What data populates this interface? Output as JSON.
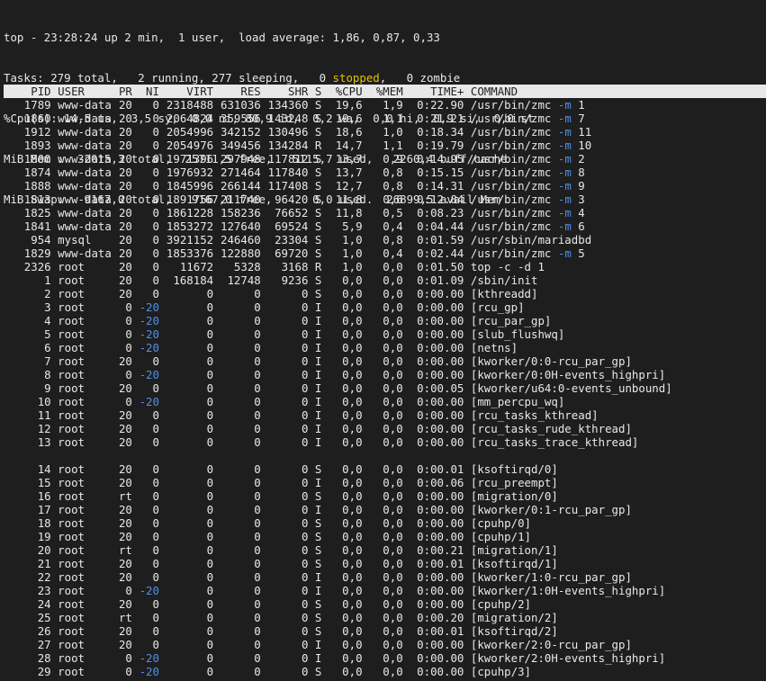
{
  "summary": {
    "top_line": "top - 23:28:24 up 2 min,  1 user,  load average: 1,86, 0,87, 0,33",
    "tasks_prefix": "Tasks: 279 total,   2 running, 277 sleeping,   0 ",
    "tasks_stopped": "stopped",
    "tasks_suffix": ",   0 zombie",
    "cpu_line": "%Cpu(s): 14,5 us,  3,5 sy,  0,0 ni, 80,9 id,  0,2 wa,  0,0 hi,  0,9 si,  0,0 st",
    "mem_line": "MiB Mem :  32015,3 total,  25711,5 free,   5115,7 used,   2260,4 buff/cache",
    "swap_line": "MiB Swap:   9167,0 total,   9167,0 free,      0,0 used.  26899,5 avail Mem"
  },
  "columns": [
    "PID",
    "USER",
    "PR",
    "NI",
    "VIRT",
    "RES",
    "SHR",
    "S",
    "%CPU",
    "%MEM",
    "TIME+",
    "COMMAND"
  ],
  "colors": {
    "ni_highlight": "#4f8fe6",
    "flag_highlight": "#4f8fe6",
    "stopped": "#e5c100"
  },
  "processes": [
    {
      "pid": "1789",
      "user": "www-data",
      "pr": "20",
      "ni": "0",
      "virt": "2318488",
      "res": "631036",
      "shr": "134360",
      "s": "S",
      "cpu": "19,6",
      "mem": "1,9",
      "time": "0:22.90",
      "cmd": "/usr/bin/zmc",
      "flag": "-m",
      "arg": "1"
    },
    {
      "pid": "1860",
      "user": "www-data",
      "pr": "20",
      "ni": "0",
      "virt": "2064824",
      "res": "359556",
      "shr": "143248",
      "s": "S",
      "cpu": "19,6",
      "mem": "1,1",
      "time": "0:21.21",
      "cmd": "/usr/bin/zmc",
      "flag": "-m",
      "arg": "7"
    },
    {
      "pid": "1912",
      "user": "www-data",
      "pr": "20",
      "ni": "0",
      "virt": "2054996",
      "res": "342152",
      "shr": "130496",
      "s": "S",
      "cpu": "18,6",
      "mem": "1,0",
      "time": "0:18.34",
      "cmd": "/usr/bin/zmc",
      "flag": "-m",
      "arg": "11"
    },
    {
      "pid": "1893",
      "user": "www-data",
      "pr": "20",
      "ni": "0",
      "virt": "2054976",
      "res": "349456",
      "shr": "134284",
      "s": "R",
      "cpu": "14,7",
      "mem": "1,1",
      "time": "0:19.79",
      "cmd": "/usr/bin/zmc",
      "flag": "-m",
      "arg": "10"
    },
    {
      "pid": "1800",
      "user": "www-data",
      "pr": "20",
      "ni": "0",
      "virt": "1971396",
      "res": "297948",
      "shr": "117812",
      "s": "S",
      "cpu": "13,7",
      "mem": "0,9",
      "time": "0:14.95",
      "cmd": "/usr/bin/zmc",
      "flag": "-m",
      "arg": "2"
    },
    {
      "pid": "1874",
      "user": "www-data",
      "pr": "20",
      "ni": "0",
      "virt": "1976932",
      "res": "271464",
      "shr": "117840",
      "s": "S",
      "cpu": "13,7",
      "mem": "0,8",
      "time": "0:15.15",
      "cmd": "/usr/bin/zmc",
      "flag": "-m",
      "arg": "8"
    },
    {
      "pid": "1888",
      "user": "www-data",
      "pr": "20",
      "ni": "0",
      "virt": "1845996",
      "res": "266144",
      "shr": "117408",
      "s": "S",
      "cpu": "12,7",
      "mem": "0,8",
      "time": "0:14.31",
      "cmd": "/usr/bin/zmc",
      "flag": "-m",
      "arg": "9"
    },
    {
      "pid": "1813",
      "user": "www-data",
      "pr": "20",
      "ni": "0",
      "virt": "1891756",
      "res": "211740",
      "shr": "96420",
      "s": "S",
      "cpu": "11,8",
      "mem": "0,6",
      "time": "0:12.84",
      "cmd": "/usr/bin/zmc",
      "flag": "-m",
      "arg": "3"
    },
    {
      "pid": "1825",
      "user": "www-data",
      "pr": "20",
      "ni": "0",
      "virt": "1861228",
      "res": "158236",
      "shr": "76652",
      "s": "S",
      "cpu": "11,8",
      "mem": "0,5",
      "time": "0:08.23",
      "cmd": "/usr/bin/zmc",
      "flag": "-m",
      "arg": "4"
    },
    {
      "pid": "1841",
      "user": "www-data",
      "pr": "20",
      "ni": "0",
      "virt": "1853272",
      "res": "127640",
      "shr": "69524",
      "s": "S",
      "cpu": "5,9",
      "mem": "0,4",
      "time": "0:04.44",
      "cmd": "/usr/bin/zmc",
      "flag": "-m",
      "arg": "6"
    },
    {
      "pid": "954",
      "user": "mysql",
      "pr": "20",
      "ni": "0",
      "virt": "3921152",
      "res": "246460",
      "shr": "23304",
      "s": "S",
      "cpu": "1,0",
      "mem": "0,8",
      "time": "0:01.59",
      "cmd": "/usr/sbin/mariadbd"
    },
    {
      "pid": "1829",
      "user": "www-data",
      "pr": "20",
      "ni": "0",
      "virt": "1853376",
      "res": "122880",
      "shr": "69720",
      "s": "S",
      "cpu": "1,0",
      "mem": "0,4",
      "time": "0:02.44",
      "cmd": "/usr/bin/zmc",
      "flag": "-m",
      "arg": "5"
    },
    {
      "pid": "2326",
      "user": "root",
      "pr": "20",
      "ni": "0",
      "virt": "11672",
      "res": "5328",
      "shr": "3168",
      "s": "R",
      "cpu": "1,0",
      "mem": "0,0",
      "time": "0:01.50",
      "cmd": "top -c -d 1"
    },
    {
      "pid": "1",
      "user": "root",
      "pr": "20",
      "ni": "0",
      "virt": "168184",
      "res": "12748",
      "shr": "9236",
      "s": "S",
      "cpu": "0,0",
      "mem": "0,0",
      "time": "0:01.09",
      "cmd": "/sbin/init"
    },
    {
      "pid": "2",
      "user": "root",
      "pr": "20",
      "ni": "0",
      "virt": "0",
      "res": "0",
      "shr": "0",
      "s": "S",
      "cpu": "0,0",
      "mem": "0,0",
      "time": "0:00.00",
      "cmd": "[kthreadd]"
    },
    {
      "pid": "3",
      "user": "root",
      "pr": "0",
      "ni": "-20",
      "virt": "0",
      "res": "0",
      "shr": "0",
      "s": "I",
      "cpu": "0,0",
      "mem": "0,0",
      "time": "0:00.00",
      "cmd": "[rcu_gp]"
    },
    {
      "pid": "4",
      "user": "root",
      "pr": "0",
      "ni": "-20",
      "virt": "0",
      "res": "0",
      "shr": "0",
      "s": "I",
      "cpu": "0,0",
      "mem": "0,0",
      "time": "0:00.00",
      "cmd": "[rcu_par_gp]"
    },
    {
      "pid": "5",
      "user": "root",
      "pr": "0",
      "ni": "-20",
      "virt": "0",
      "res": "0",
      "shr": "0",
      "s": "I",
      "cpu": "0,0",
      "mem": "0,0",
      "time": "0:00.00",
      "cmd": "[slub_flushwq]"
    },
    {
      "pid": "6",
      "user": "root",
      "pr": "0",
      "ni": "-20",
      "virt": "0",
      "res": "0",
      "shr": "0",
      "s": "I",
      "cpu": "0,0",
      "mem": "0,0",
      "time": "0:00.00",
      "cmd": "[netns]"
    },
    {
      "pid": "7",
      "user": "root",
      "pr": "20",
      "ni": "0",
      "virt": "0",
      "res": "0",
      "shr": "0",
      "s": "I",
      "cpu": "0,0",
      "mem": "0,0",
      "time": "0:00.00",
      "cmd": "[kworker/0:0-rcu_par_gp]"
    },
    {
      "pid": "8",
      "user": "root",
      "pr": "0",
      "ni": "-20",
      "virt": "0",
      "res": "0",
      "shr": "0",
      "s": "I",
      "cpu": "0,0",
      "mem": "0,0",
      "time": "0:00.00",
      "cmd": "[kworker/0:0H-events_highpri]"
    },
    {
      "pid": "9",
      "user": "root",
      "pr": "20",
      "ni": "0",
      "virt": "0",
      "res": "0",
      "shr": "0",
      "s": "I",
      "cpu": "0,0",
      "mem": "0,0",
      "time": "0:00.05",
      "cmd": "[kworker/u64:0-events_unbound]"
    },
    {
      "pid": "10",
      "user": "root",
      "pr": "0",
      "ni": "-20",
      "virt": "0",
      "res": "0",
      "shr": "0",
      "s": "I",
      "cpu": "0,0",
      "mem": "0,0",
      "time": "0:00.00",
      "cmd": "[mm_percpu_wq]"
    },
    {
      "pid": "11",
      "user": "root",
      "pr": "20",
      "ni": "0",
      "virt": "0",
      "res": "0",
      "shr": "0",
      "s": "I",
      "cpu": "0,0",
      "mem": "0,0",
      "time": "0:00.00",
      "cmd": "[rcu_tasks_kthread]"
    },
    {
      "pid": "12",
      "user": "root",
      "pr": "20",
      "ni": "0",
      "virt": "0",
      "res": "0",
      "shr": "0",
      "s": "I",
      "cpu": "0,0",
      "mem": "0,0",
      "time": "0:00.00",
      "cmd": "[rcu_tasks_rude_kthread]"
    },
    {
      "pid": "13",
      "user": "root",
      "pr": "20",
      "ni": "0",
      "virt": "0",
      "res": "0",
      "shr": "0",
      "s": "I",
      "cpu": "0,0",
      "mem": "0,0",
      "time": "0:00.00",
      "cmd": "[rcu_tasks_trace_kthread]"
    },
    {
      "blank": true
    },
    {
      "pid": "14",
      "user": "root",
      "pr": "20",
      "ni": "0",
      "virt": "0",
      "res": "0",
      "shr": "0",
      "s": "S",
      "cpu": "0,0",
      "mem": "0,0",
      "time": "0:00.01",
      "cmd": "[ksoftirqd/0]"
    },
    {
      "pid": "15",
      "user": "root",
      "pr": "20",
      "ni": "0",
      "virt": "0",
      "res": "0",
      "shr": "0",
      "s": "I",
      "cpu": "0,0",
      "mem": "0,0",
      "time": "0:00.06",
      "cmd": "[rcu_preempt]"
    },
    {
      "pid": "16",
      "user": "root",
      "pr": "rt",
      "ni": "0",
      "virt": "0",
      "res": "0",
      "shr": "0",
      "s": "S",
      "cpu": "0,0",
      "mem": "0,0",
      "time": "0:00.00",
      "cmd": "[migration/0]"
    },
    {
      "pid": "17",
      "user": "root",
      "pr": "20",
      "ni": "0",
      "virt": "0",
      "res": "0",
      "shr": "0",
      "s": "I",
      "cpu": "0,0",
      "mem": "0,0",
      "time": "0:00.00",
      "cmd": "[kworker/0:1-rcu_par_gp]"
    },
    {
      "pid": "18",
      "user": "root",
      "pr": "20",
      "ni": "0",
      "virt": "0",
      "res": "0",
      "shr": "0",
      "s": "S",
      "cpu": "0,0",
      "mem": "0,0",
      "time": "0:00.00",
      "cmd": "[cpuhp/0]"
    },
    {
      "pid": "19",
      "user": "root",
      "pr": "20",
      "ni": "0",
      "virt": "0",
      "res": "0",
      "shr": "0",
      "s": "S",
      "cpu": "0,0",
      "mem": "0,0",
      "time": "0:00.00",
      "cmd": "[cpuhp/1]"
    },
    {
      "pid": "20",
      "user": "root",
      "pr": "rt",
      "ni": "0",
      "virt": "0",
      "res": "0",
      "shr": "0",
      "s": "S",
      "cpu": "0,0",
      "mem": "0,0",
      "time": "0:00.21",
      "cmd": "[migration/1]"
    },
    {
      "pid": "21",
      "user": "root",
      "pr": "20",
      "ni": "0",
      "virt": "0",
      "res": "0",
      "shr": "0",
      "s": "S",
      "cpu": "0,0",
      "mem": "0,0",
      "time": "0:00.01",
      "cmd": "[ksoftirqd/1]"
    },
    {
      "pid": "22",
      "user": "root",
      "pr": "20",
      "ni": "0",
      "virt": "0",
      "res": "0",
      "shr": "0",
      "s": "I",
      "cpu": "0,0",
      "mem": "0,0",
      "time": "0:00.00",
      "cmd": "[kworker/1:0-rcu_par_gp]"
    },
    {
      "pid": "23",
      "user": "root",
      "pr": "0",
      "ni": "-20",
      "virt": "0",
      "res": "0",
      "shr": "0",
      "s": "I",
      "cpu": "0,0",
      "mem": "0,0",
      "time": "0:00.00",
      "cmd": "[kworker/1:0H-events_highpri]"
    },
    {
      "pid": "24",
      "user": "root",
      "pr": "20",
      "ni": "0",
      "virt": "0",
      "res": "0",
      "shr": "0",
      "s": "S",
      "cpu": "0,0",
      "mem": "0,0",
      "time": "0:00.00",
      "cmd": "[cpuhp/2]"
    },
    {
      "pid": "25",
      "user": "root",
      "pr": "rt",
      "ni": "0",
      "virt": "0",
      "res": "0",
      "shr": "0",
      "s": "S",
      "cpu": "0,0",
      "mem": "0,0",
      "time": "0:00.20",
      "cmd": "[migration/2]"
    },
    {
      "pid": "26",
      "user": "root",
      "pr": "20",
      "ni": "0",
      "virt": "0",
      "res": "0",
      "shr": "0",
      "s": "S",
      "cpu": "0,0",
      "mem": "0,0",
      "time": "0:00.01",
      "cmd": "[ksoftirqd/2]"
    },
    {
      "pid": "27",
      "user": "root",
      "pr": "20",
      "ni": "0",
      "virt": "0",
      "res": "0",
      "shr": "0",
      "s": "I",
      "cpu": "0,0",
      "mem": "0,0",
      "time": "0:00.00",
      "cmd": "[kworker/2:0-rcu_par_gp]"
    },
    {
      "pid": "28",
      "user": "root",
      "pr": "0",
      "ni": "-20",
      "virt": "0",
      "res": "0",
      "shr": "0",
      "s": "I",
      "cpu": "0,0",
      "mem": "0,0",
      "time": "0:00.00",
      "cmd": "[kworker/2:0H-events_highpri]"
    },
    {
      "pid": "29",
      "user": "root",
      "pr": "0",
      "ni": "-20",
      "virt": "0",
      "res": "0",
      "shr": "0",
      "s": "S",
      "cpu": "0,0",
      "mem": "0,0",
      "time": "0:00.00",
      "cmd": "[cpuhp/3]"
    }
  ]
}
